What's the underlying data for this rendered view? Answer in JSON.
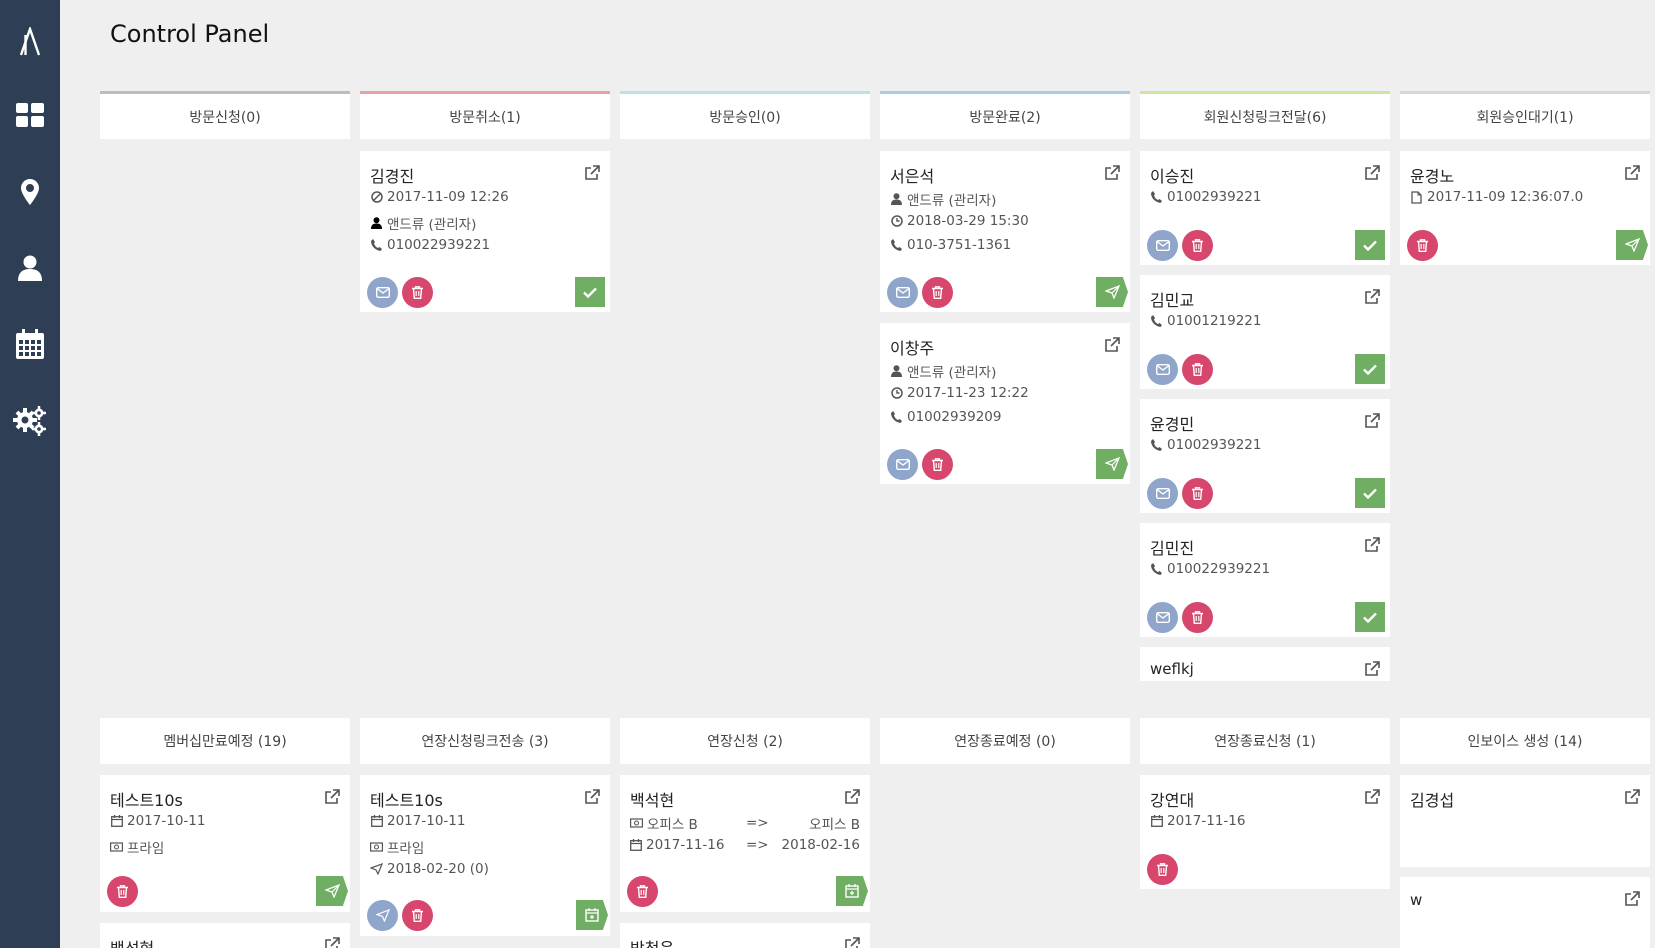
{
  "page_title": "Control Panel",
  "colors": {
    "sidebar": "#2e3f55",
    "mail_button": "#8fa5c9",
    "delete_button": "#d6466d",
    "action_button": "#6fae63"
  },
  "top_columns": [
    {
      "title": "방문신청(0)",
      "accent": "#bdbdbd"
    },
    {
      "title": "방문취소(1)",
      "accent": "#e6a3a6"
    },
    {
      "title": "방문승인(0)",
      "accent": "#bfe0e3"
    },
    {
      "title": "방문완료(2)",
      "accent": "#a9cce6"
    },
    {
      "title": "회원신청링크전달(6)",
      "accent": "#cfe6a0"
    },
    {
      "title": "회원승인대기(1)",
      "accent": "#d6d6d6"
    }
  ],
  "bottom_columns": [
    {
      "title": "멤버십만료예정 (19)"
    },
    {
      "title": "연장신청링크전송 (3)"
    },
    {
      "title": "연장신청 (2)"
    },
    {
      "title": "연장종료예정 (0)"
    },
    {
      "title": "연장종료신청 (1)"
    },
    {
      "title": "인보이스 생성 (14)"
    }
  ],
  "cards": {
    "cancel_1": {
      "name": "김경진",
      "datetime": "2017-11-09 12:26",
      "manager": "앤드류 (관리자)",
      "phone": "010022939221"
    },
    "done_1": {
      "name": "서은석",
      "manager": "앤드류 (관리자)",
      "datetime": "2018-03-29 15:30",
      "phone": "010-3751-1361"
    },
    "done_2": {
      "name": "이창주",
      "manager": "앤드류 (관리자)",
      "datetime": "2017-11-23 12:22",
      "phone": "01002939209"
    },
    "link_1": {
      "name": "이승진",
      "phone": "01002939221"
    },
    "link_2": {
      "name": "김민교",
      "phone": "01001219221"
    },
    "link_3": {
      "name": "윤경민",
      "phone": "01002939221"
    },
    "link_4": {
      "name": "김민진",
      "phone": "010022939221"
    },
    "link_5": {
      "name": "weflkj"
    },
    "wait_1": {
      "name": "윤경노",
      "doc": "2017-11-09 12:36:07.0"
    },
    "expire_1": {
      "name": "테스트10s",
      "date": "2017-10-11",
      "plan": "프라임"
    },
    "expire_2": {
      "name": "백석현"
    },
    "extlink_1": {
      "name": "테스트10s",
      "date": "2017-10-11",
      "plan": "프라임",
      "sent": "2018-02-20 (0)"
    },
    "extreq_1": {
      "name": "백석현",
      "office_from": "오피스 B",
      "office_to": "오피스 B",
      "date_from": "2017-11-16",
      "date_to": "2018-02-16",
      "arrow": "=>"
    },
    "extreq_2": {
      "name": "박청운"
    },
    "extend_1": {
      "name": "강연대",
      "date": "2017-11-16"
    },
    "invoice_1": {
      "name": "김경섭"
    },
    "invoice_2": {
      "name": "w"
    }
  }
}
